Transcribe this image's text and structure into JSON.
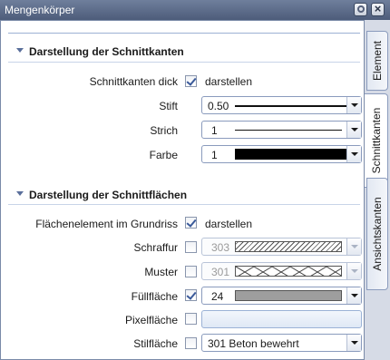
{
  "window": {
    "title": "Mengenkörper"
  },
  "tabs": [
    {
      "label": "Element"
    },
    {
      "label": "Schnittkanten"
    },
    {
      "label": "Ansichtskanten"
    }
  ],
  "section1": {
    "title": "Darstellung der Schnittkanten",
    "rows": {
      "dick": {
        "label": "Schnittkanten dick",
        "checkbox_label": "darstellen",
        "checked": true
      },
      "stift": {
        "label": "Stift",
        "value": "0.50"
      },
      "strich": {
        "label": "Strich",
        "value": "1"
      },
      "farbe": {
        "label": "Farbe",
        "value": "1",
        "color": "#000000"
      }
    }
  },
  "section2": {
    "title": "Darstellung der Schnittflächen",
    "rows": {
      "flaeche": {
        "label": "Flächenelement im Grundriss",
        "checkbox_label": "darstellen",
        "checked": true
      },
      "schraffur": {
        "label": "Schraffur",
        "value": "303",
        "checked": false,
        "enabled": false
      },
      "muster": {
        "label": "Muster",
        "value": "301",
        "checked": false,
        "enabled": false
      },
      "fuellflaeche": {
        "label": "Füllfläche",
        "value": "24",
        "checked": true,
        "color": "#9e9e9e"
      },
      "pixelflaeche": {
        "label": "Pixelfläche",
        "checked": false
      },
      "stilflaeche": {
        "label": "Stilfläche",
        "value": "301 Beton bewehrt",
        "checked": false
      }
    }
  }
}
